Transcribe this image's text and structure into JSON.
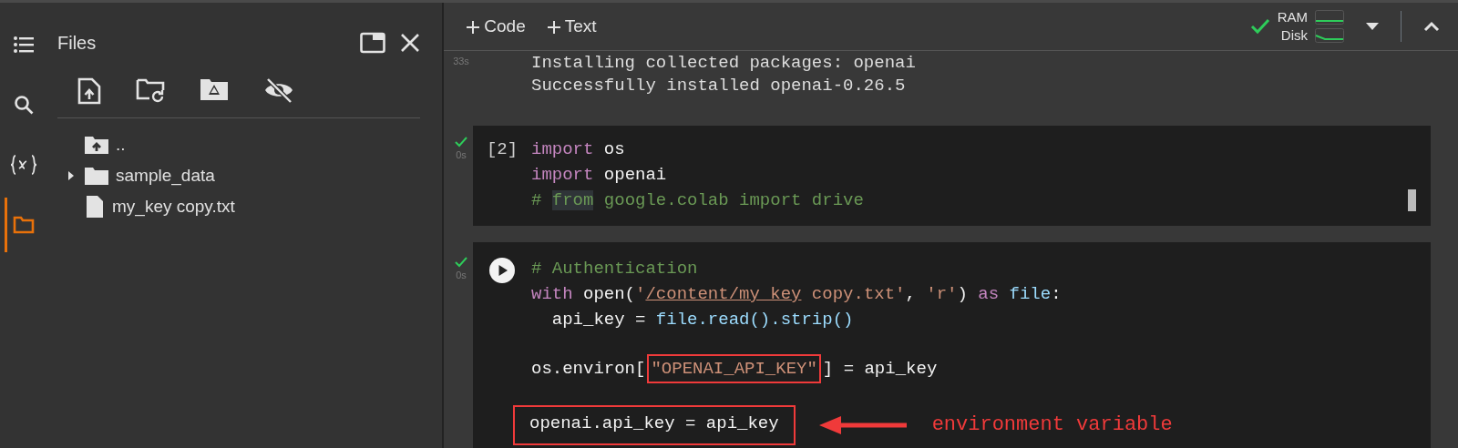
{
  "rail": [
    {
      "kind": "menu",
      "selected": false
    },
    {
      "kind": "search",
      "selected": false
    },
    {
      "kind": "variables",
      "selected": false
    },
    {
      "kind": "files",
      "selected": true
    }
  ],
  "files_panel": {
    "title": "Files",
    "toolbar": [
      {
        "kind": "upload"
      },
      {
        "kind": "refresh"
      },
      {
        "kind": "drive"
      },
      {
        "kind": "hide"
      }
    ],
    "tree": [
      {
        "name": "..",
        "kind": "parent"
      },
      {
        "name": "sample_data",
        "kind": "folder",
        "expanded": false
      },
      {
        "name": "my_key copy.txt",
        "kind": "file"
      }
    ]
  },
  "toolbar": {
    "buttons": [
      "Code",
      "Text"
    ],
    "resources": {
      "connected": true,
      "ram": "RAM",
      "disk": "Disk"
    }
  },
  "cells": [
    {
      "kind": "output",
      "exec_time": "33s",
      "lines": [
        {
          "tokens": [
            {
              "kind": "output",
              "text": "Installing collected packages: openai"
            }
          ]
        },
        {
          "tokens": [
            {
              "kind": "output",
              "text": "Successfully installed openai-0.26.5"
            }
          ]
        }
      ]
    },
    {
      "kind": "code",
      "prompt": "[2]",
      "done": true,
      "exec_time": "0s",
      "scrollbar": true,
      "lines": [
        {
          "tokens": [
            {
              "kind": "keyword",
              "text": "import"
            },
            {
              "kind": "plain",
              "text": " os"
            }
          ]
        },
        {
          "tokens": [
            {
              "kind": "keyword",
              "text": "import"
            },
            {
              "kind": "plain",
              "text": " openai"
            }
          ]
        },
        {
          "tokens": [
            {
              "kind": "comment",
              "text": "# "
            },
            {
              "kind": "comment",
              "text": "from",
              "highlighted": true
            },
            {
              "kind": "comment",
              "text": " google.colab import drive"
            }
          ]
        }
      ]
    },
    {
      "kind": "code",
      "run_button": true,
      "done": true,
      "exec_time": "0s",
      "lines": [
        {
          "tokens": [
            {
              "kind": "comment",
              "text": "# Authentication"
            }
          ]
        },
        {
          "tokens": [
            {
              "kind": "keyword",
              "text": "with"
            },
            {
              "kind": "plain",
              "text": " open("
            },
            {
              "kind": "string",
              "text": "'"
            },
            {
              "kind": "string",
              "text": "/content/my_key",
              "underlined": true
            },
            {
              "kind": "string",
              "text": " copy.txt'"
            },
            {
              "kind": "plain",
              "text": ", "
            },
            {
              "kind": "string",
              "text": "'r'"
            },
            {
              "kind": "plain",
              "text": ") "
            },
            {
              "kind": "keyword",
              "text": "as"
            },
            {
              "kind": "variable",
              "text": " file"
            },
            {
              "kind": "plain",
              "text": ":"
            }
          ]
        },
        {
          "tokens": [
            {
              "kind": "plain",
              "text": "  api_key = "
            },
            {
              "kind": "variable",
              "text": "file.read().strip()"
            }
          ]
        },
        {
          "spaced_before": true,
          "tokens": [
            {
              "kind": "plain",
              "text": "os.environ["
            },
            {
              "kind": "string",
              "text": "\"OPENAI_API_KEY\"",
              "boxed": true
            },
            {
              "kind": "plain",
              "text": "] = api_key"
            }
          ]
        },
        {
          "spaced_before": true,
          "boxed": true,
          "tokens": [
            {
              "kind": "plain",
              "text": "openai.api_key = api_key"
            }
          ]
        }
      ]
    }
  ],
  "annotation": {
    "text": "environment variable"
  }
}
